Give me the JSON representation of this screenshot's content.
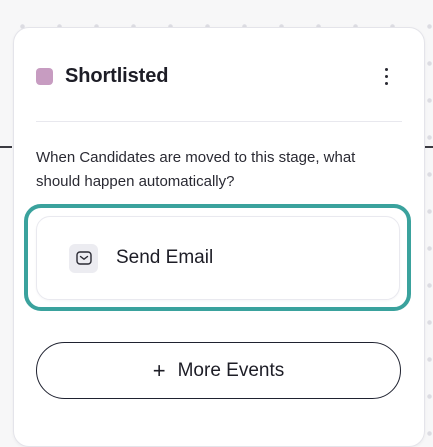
{
  "stage": {
    "title": "Shortlisted",
    "color": "#c79cc1"
  },
  "prompt": {
    "text": "When Candidates are moved to this stage, what should happen automatically?"
  },
  "events": [
    {
      "label": "Send Email",
      "icon": "email-icon"
    }
  ],
  "actions": {
    "more_events_label": "More Events",
    "more_events_icon": "plus-icon"
  },
  "colors": {
    "highlight": "#3aa29d",
    "text": "#1d1d26"
  }
}
